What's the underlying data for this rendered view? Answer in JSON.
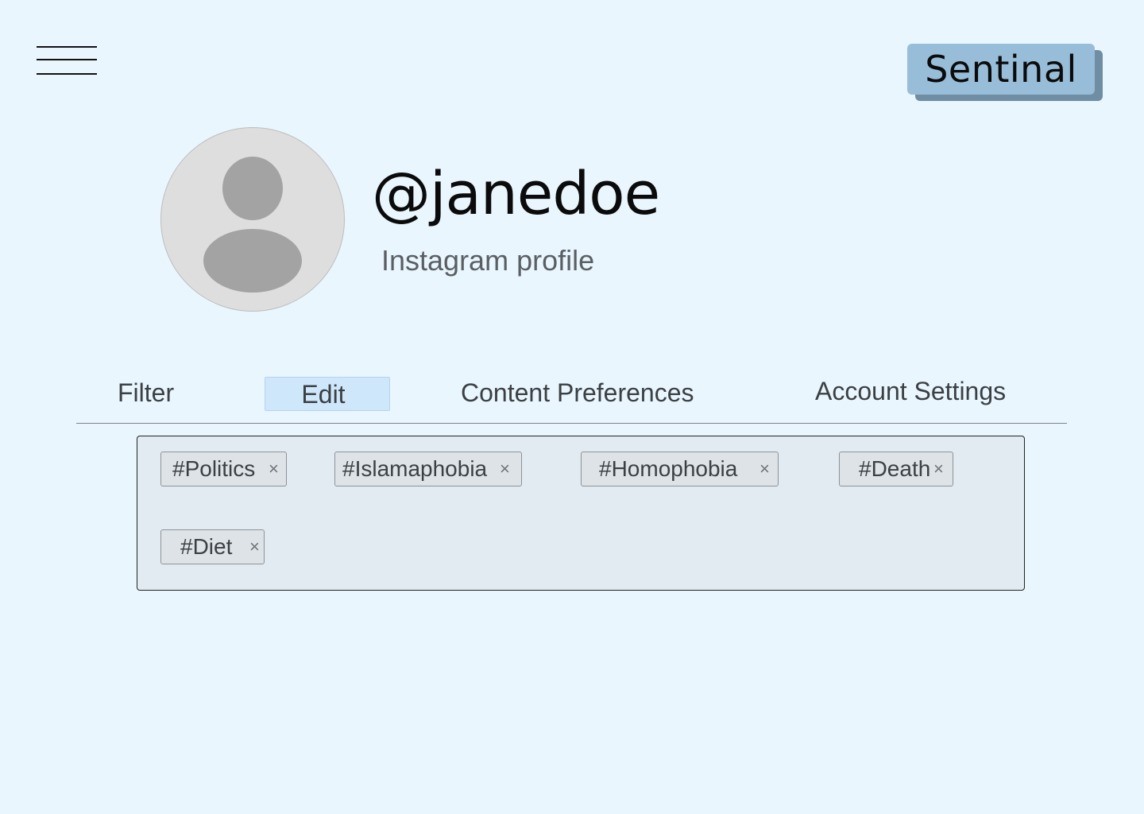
{
  "header": {
    "menu_icon": "hamburger-menu-icon",
    "brand_label": "Sentinal"
  },
  "profile": {
    "username": "@janedoe",
    "subtitle": "Instagram profile",
    "avatar_icon": "user-placeholder-icon"
  },
  "tabs": [
    {
      "label": "Filter",
      "active": false
    },
    {
      "label": "Edit",
      "active": true
    },
    {
      "label": "Content Preferences",
      "active": false
    },
    {
      "label": "Account Settings",
      "active": false
    }
  ],
  "tags": [
    {
      "label": "#Politics",
      "remove": "×"
    },
    {
      "label": "#Islamaphobia",
      "remove": "×"
    },
    {
      "label": "#Homophobia",
      "remove": "×"
    },
    {
      "label": "#Death",
      "remove": "×"
    },
    {
      "label": "#Diet",
      "remove": "×"
    }
  ],
  "colors": {
    "background": "#E9F6FE",
    "brand_button": "#98BDD8",
    "active_tab": "#CFE7FB",
    "tag_panel": "#E1EBF1"
  }
}
